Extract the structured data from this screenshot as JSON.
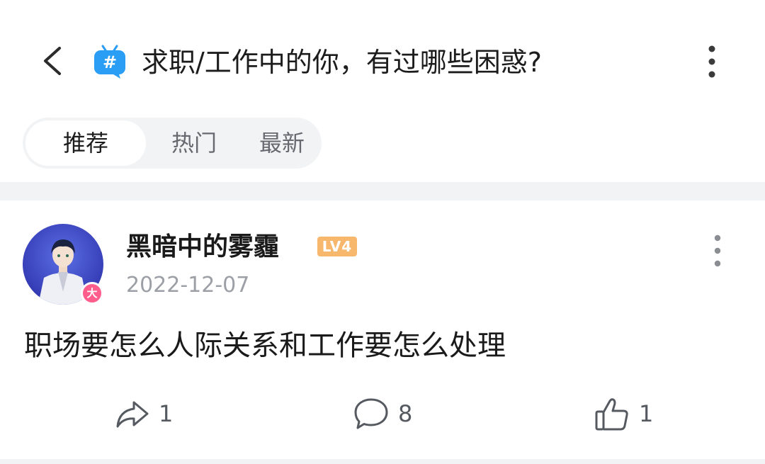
{
  "header": {
    "title": "求职/工作中的你，有过哪些困惑?",
    "topic_icon_symbol": "#",
    "back_icon": "chevron-left-icon",
    "more_icon": "more-vertical-icon"
  },
  "tabs": [
    {
      "label": "推荐",
      "active": true
    },
    {
      "label": "热门",
      "active": false
    },
    {
      "label": "最新",
      "active": false
    }
  ],
  "post": {
    "author": "黑暗中的雾霾",
    "level": "LV4",
    "avatar_badge": "大",
    "date": "2022-12-07",
    "content": "职场要怎么人际关系和工作要怎么处理",
    "actions": {
      "share_count": "1",
      "comment_count": "8",
      "like_count": "1"
    }
  },
  "colors": {
    "topic_icon": "#2a9df4",
    "tab_bg": "#f2f3f5",
    "level_badge": "#f7b86e",
    "avatar_badge": "#ff5e8c",
    "muted_text": "#9c9fa5"
  }
}
